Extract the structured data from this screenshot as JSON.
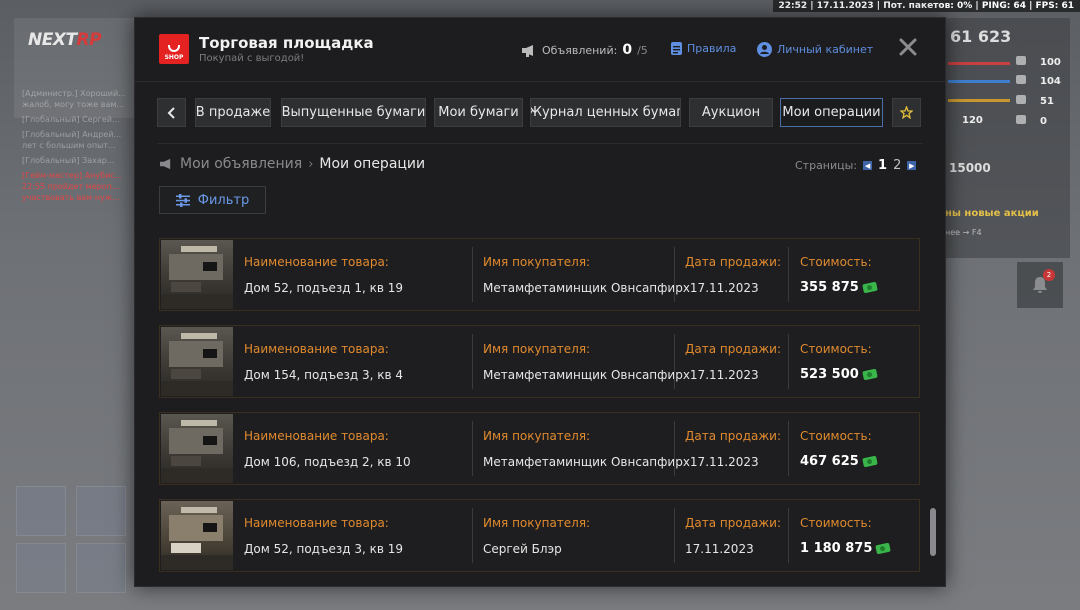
{
  "hud": {
    "topbar": "22:52 | 17.11.2023 | Пот. пакетов: 0% | PING: 64 | FPS: 61",
    "brand_a": "NEXT",
    "brand_b": "RP",
    "money_big": "61 623",
    "money_small": "15000",
    "promo": "ны новые акции",
    "promo2": "нее → F4",
    "stats": [
      "100",
      "104",
      "51",
      "120",
      "0"
    ],
    "bell_count": "2",
    "chat": [
      "[Администр.] Хороший...",
      "жалоб, могу тоже вам...",
      "[Глобальный] Сергей...",
      "[Глобальный] Андрей...",
      "лет с большим опыт...",
      "[Глобальный] Захар..."
    ],
    "chat_red": "[Гейм-мастер] Анубис... 22:55 пройдет мероп... участвовать вам нуж..."
  },
  "header": {
    "logo_text": "SHOP",
    "title": "Торговая площадка",
    "subtitle": "Покупай с выгодой!",
    "ads_label": "Объявлений:",
    "ads_count": "0",
    "ads_total": "/5",
    "rules": "Правила",
    "cabinet": "Личный кабинет"
  },
  "tabs": [
    {
      "label": "В продаже"
    },
    {
      "label": "Выпущенные бумаги"
    },
    {
      "label": "Мои бумаги"
    },
    {
      "label": "Журнал ценных бумаг"
    },
    {
      "label": "Аукцион"
    },
    {
      "label": "Мои операции"
    }
  ],
  "breadcrumb": {
    "root": "Мои объявления",
    "current": "Мои операции"
  },
  "pagination": {
    "label": "Страницы:",
    "pages": [
      "1",
      "2"
    ],
    "current": "1"
  },
  "filter_label": "Фильтр",
  "columns": {
    "item": "Наименование товара:",
    "buyer": "Имя покупателя:",
    "date": "Дата продажи:",
    "price": "Стоимость:"
  },
  "rows": [
    {
      "item": "Дом 52, подъезд 1, кв 19",
      "buyer": "Метамфетаминщик Овнсапфирх17.11.2023",
      "date": "",
      "price": "355 875"
    },
    {
      "item": "Дом 154, подъезд 3, кв 4",
      "buyer": "Метамфетаминщик Овнсапфирх17.11.2023",
      "date": "",
      "price": "523 500"
    },
    {
      "item": "Дом 106, подъезд 2, кв 10",
      "buyer": "Метамфетаминщик Овнсапфирх17.11.2023",
      "date": "",
      "price": "467 625"
    },
    {
      "item": "Дом 52, подъезд 3, кв 19",
      "buyer": "Сергей Блэр",
      "date": "17.11.2023",
      "price": "1 180 875"
    }
  ],
  "colors": {
    "accent_blue": "#5f8fe0",
    "label_orange": "#e08a2e",
    "logo_red": "#e52222",
    "star_gold": "#e2c03b"
  }
}
